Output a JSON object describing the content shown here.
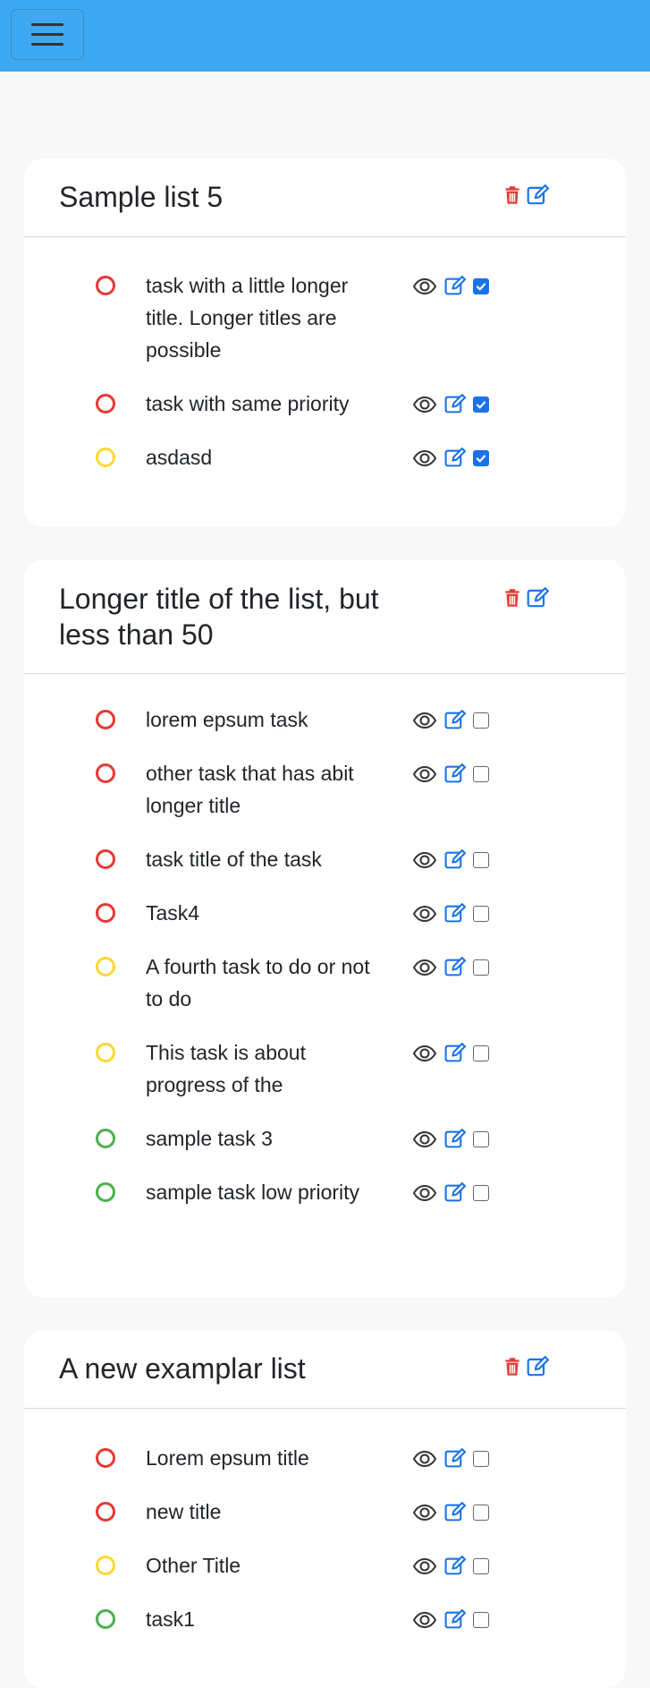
{
  "header": {
    "menu_icon": "hamburger-icon",
    "color": "#3fa8f2"
  },
  "colors": {
    "high": "#e53935",
    "medium": "#fdd835",
    "low": "#4caf50",
    "delete": "#e53935",
    "edit": "#1a73e8"
  },
  "lists": [
    {
      "title": "Sample list 5",
      "tasks": [
        {
          "title": "task with a little longer title. Longer titles are possible",
          "priority": "high",
          "done": true
        },
        {
          "title": "task with same priority",
          "priority": "high",
          "done": true
        },
        {
          "title": "asdasd",
          "priority": "medium",
          "done": true
        }
      ]
    },
    {
      "title": "Longer title of the list, but less than 50",
      "tasks": [
        {
          "title": "lorem epsum task",
          "priority": "high",
          "done": false
        },
        {
          "title": "other task that has abit longer title",
          "priority": "high",
          "done": false
        },
        {
          "title": "task title of the task",
          "priority": "high",
          "done": false
        },
        {
          "title": "Task4",
          "priority": "high",
          "done": false
        },
        {
          "title": "A fourth task to do or not to do",
          "priority": "medium",
          "done": false
        },
        {
          "title": "This task is about progress of the",
          "priority": "medium",
          "done": false
        },
        {
          "title": "sample task 3",
          "priority": "low",
          "done": false
        },
        {
          "title": "sample task low priority",
          "priority": "low",
          "done": false
        }
      ]
    },
    {
      "title": "A new examplar list",
      "tasks": [
        {
          "title": "Lorem epsum title",
          "priority": "high",
          "done": false
        },
        {
          "title": "new title",
          "priority": "high",
          "done": false
        },
        {
          "title": "Other Title",
          "priority": "medium",
          "done": false
        },
        {
          "title": "task1",
          "priority": "low",
          "done": false
        }
      ]
    }
  ]
}
